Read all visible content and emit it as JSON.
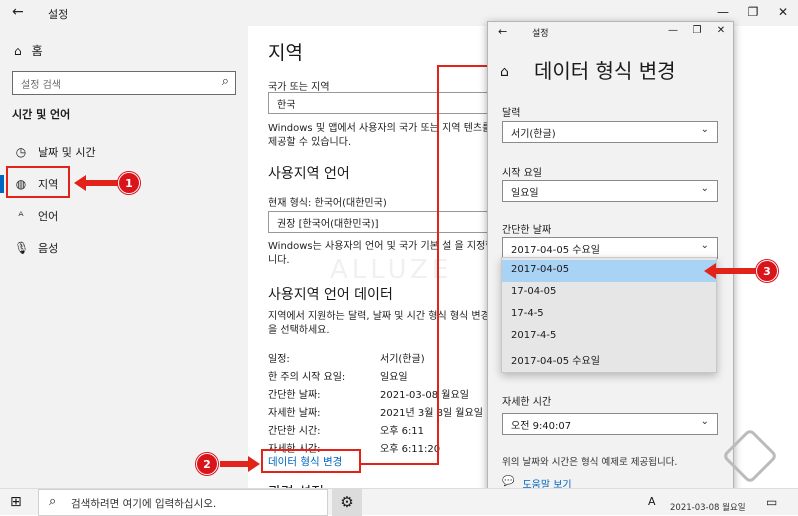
{
  "window": {
    "back": "←",
    "title": "설정",
    "controls": [
      "—",
      "❐",
      "✕"
    ]
  },
  "nav": {
    "home": "홈",
    "search_placeholder": "설정 검색",
    "section": "시간 및 언어",
    "items": [
      {
        "label": "날짜 및 시간",
        "icon": "calendar-clock-icon"
      },
      {
        "label": "지역",
        "icon": "region-globe-icon",
        "selected": true
      },
      {
        "label": "언어",
        "icon": "language-icon"
      },
      {
        "label": "음성",
        "icon": "microphone-icon"
      }
    ]
  },
  "badges": [
    "1",
    "2",
    "3"
  ],
  "main": {
    "title": "지역",
    "country_label": "국가 또는 지역",
    "country_value": "한국",
    "country_desc": "Windows 및 앱에서 사용자의 국가 또는 지역 텐츠를 제공할 수 있습니다.",
    "locale_heading": "사용지역 언어",
    "current_format": "현재 형식: 한국어(대한민국)",
    "format_value": "권장 [한국어(대한민국)]",
    "format_desc": "Windows는 사용자의 언어 및 국가 기본 설 을 지정합니다.",
    "data_heading": "사용지역 언어 데이터",
    "data_desc": "지역에서 지원하는 달력, 날짜 및 시간 형식 형식 변경]을 선택하세요.",
    "rows": [
      {
        "k": "일정:",
        "v": "서기(한글)"
      },
      {
        "k": "한 주의 시작 요일:",
        "v": "일요일"
      },
      {
        "k": "간단한 날짜:",
        "v": "2021-03-08 월요일"
      },
      {
        "k": "자세한 날짜:",
        "v": "2021년 3월 8일 월요일"
      },
      {
        "k": "간단한 시간:",
        "v": "오후 6:11"
      },
      {
        "k": "자세한 시간:",
        "v": "오후 6:11:20"
      }
    ],
    "change_link": "데이터 형식 변경",
    "bottom_heading": "관련 설정"
  },
  "panel": {
    "back": "←",
    "title": "설정",
    "heading": "데이터 형식 변경",
    "calendar_label": "달력",
    "calendar_value": "서기(한글)",
    "firstday_label": "시작 요일",
    "firstday_value": "일요일",
    "shortdate_label": "간단한 날짜",
    "shortdate_value": "2017-04-05 수요일",
    "dropdown_options": [
      "2017-04-05",
      "17-04-05",
      "17-4-5",
      "2017-4-5",
      "2017-04-05 수요일"
    ],
    "longtime_label": "자세한 시간",
    "longtime_value": "오전 9:40:07",
    "note": "위의 날짜와 시간은 형식 예제로 제공됩니다.",
    "help": "도움말 보기"
  },
  "taskbar": {
    "search_placeholder": "검색하려면 여기에 입력하십시오.",
    "ime": "A",
    "clock": "2021-03-08 월요일"
  },
  "watermark": "ALLUZE"
}
